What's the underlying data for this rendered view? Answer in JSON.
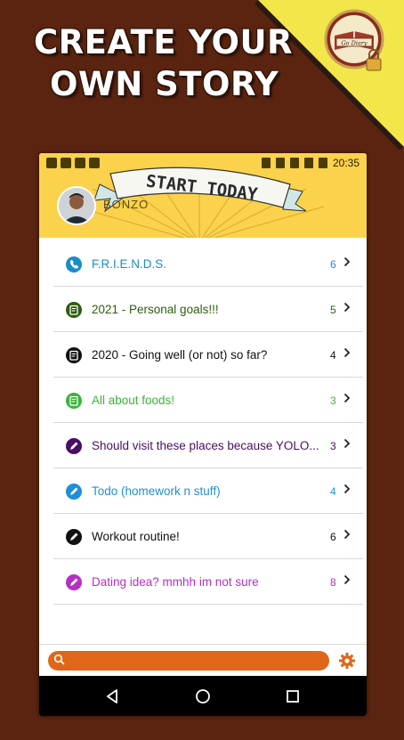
{
  "promo": {
    "line1": "CREATE YOUR",
    "line2": "OWN STORY",
    "logo_text": "Go Diary"
  },
  "status_bar": {
    "time": "20:35"
  },
  "header": {
    "banner_text": "START TODAY",
    "username": "BONZO"
  },
  "entries": [
    {
      "title": "F.R.I.E.N.D.S.",
      "count": "6",
      "color": "#1a8cc7",
      "icon": "phone-icon"
    },
    {
      "title": "2021 - Personal goals!!!",
      "count": "5",
      "color": "#2e5d0e",
      "icon": "note-icon"
    },
    {
      "title": "2020 - Going well (or not) so far?",
      "count": "4",
      "color": "#111111",
      "icon": "note-icon"
    },
    {
      "title": "All about foods!",
      "count": "3",
      "color": "#3ab53a",
      "icon": "note-icon"
    },
    {
      "title": "Should visit these places because YOLO...",
      "count": "3",
      "color": "#4a0e63",
      "icon": "pen-icon"
    },
    {
      "title": "Todo (homework n stuff)",
      "count": "4",
      "color": "#1f8fd6",
      "icon": "pen-icon"
    },
    {
      "title": "Workout routine!",
      "count": "6",
      "color": "#111111",
      "icon": "pen-icon"
    },
    {
      "title": "Dating idea? mmhh im not sure",
      "count": "8",
      "color": "#b62fc4",
      "icon": "pen-icon"
    }
  ],
  "search": {
    "placeholder": ""
  },
  "colors": {
    "accent": "#e0661a",
    "header": "#fbd24b",
    "background": "#5a2410"
  }
}
